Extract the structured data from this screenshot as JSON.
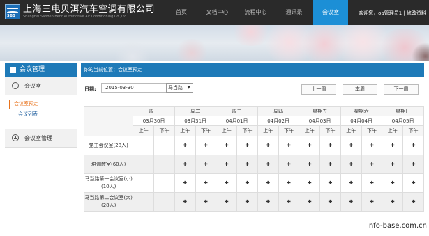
{
  "header": {
    "company_cn": "上海三电贝洱汽车空调有限公司",
    "company_en": "Shanghai Sanden Behr Automotive Air Conditioning Co.,Ltd.",
    "logo_text": "SBS",
    "nav": [
      {
        "label": "首页",
        "active": false
      },
      {
        "label": "文档中心",
        "active": false
      },
      {
        "label": "流程中心",
        "active": false
      },
      {
        "label": "通讯录",
        "active": false
      },
      {
        "label": "会议室",
        "active": true
      }
    ],
    "user_text": "欢迎您，oa管理员1 | 修改资料"
  },
  "sidebar": {
    "title": "会议管理",
    "sections": [
      {
        "label": "会议室",
        "items": [
          {
            "label": "会议室预定",
            "active": true
          },
          {
            "label": "会议列表",
            "active": false
          }
        ]
      },
      {
        "label": "会议室管理",
        "items": []
      }
    ]
  },
  "main": {
    "breadcrumb": "你的当前位置：会议室预定",
    "date_label": "日期:",
    "date_value": "2015-03-30",
    "location_value": "马当路",
    "prev_week": "上一周",
    "this_week": "本周",
    "next_week": "下一周",
    "days": [
      {
        "name": "周一",
        "date": "03月30日"
      },
      {
        "name": "周二",
        "date": "03月31日"
      },
      {
        "name": "周三",
        "date": "04月01日"
      },
      {
        "name": "周四",
        "date": "04月02日"
      },
      {
        "name": "星期五",
        "date": "04月03日"
      },
      {
        "name": "星期六",
        "date": "04月04日"
      },
      {
        "name": "星期日",
        "date": "04月05日"
      }
    ],
    "am_label": "上午",
    "pm_label": "下午",
    "rooms": [
      {
        "name": "党工会议室(28人)",
        "bookable": [
          false,
          false,
          true,
          true,
          true,
          true,
          true,
          true,
          true,
          true,
          true,
          true,
          true,
          true
        ]
      },
      {
        "name": "培训教室(60人)",
        "bookable": [
          false,
          false,
          true,
          true,
          true,
          true,
          true,
          true,
          true,
          true,
          true,
          true,
          true,
          true
        ]
      },
      {
        "name": "马当路第一会议室(小)(10人)",
        "bookable": [
          false,
          false,
          true,
          true,
          true,
          true,
          true,
          true,
          true,
          true,
          true,
          true,
          true,
          true
        ]
      },
      {
        "name": "马当路第二会议室(大)(28人)",
        "bookable": [
          false,
          false,
          true,
          true,
          true,
          true,
          true,
          true,
          true,
          true,
          true,
          true,
          true,
          true
        ]
      }
    ],
    "plus_glyph": "✚"
  },
  "watermark": "info-base.com.cn",
  "colors": {
    "header_bg": "#2a2a2a",
    "accent": "#1c8fd6",
    "bar": "#1e7ab8",
    "active_link": "#e8731d"
  }
}
